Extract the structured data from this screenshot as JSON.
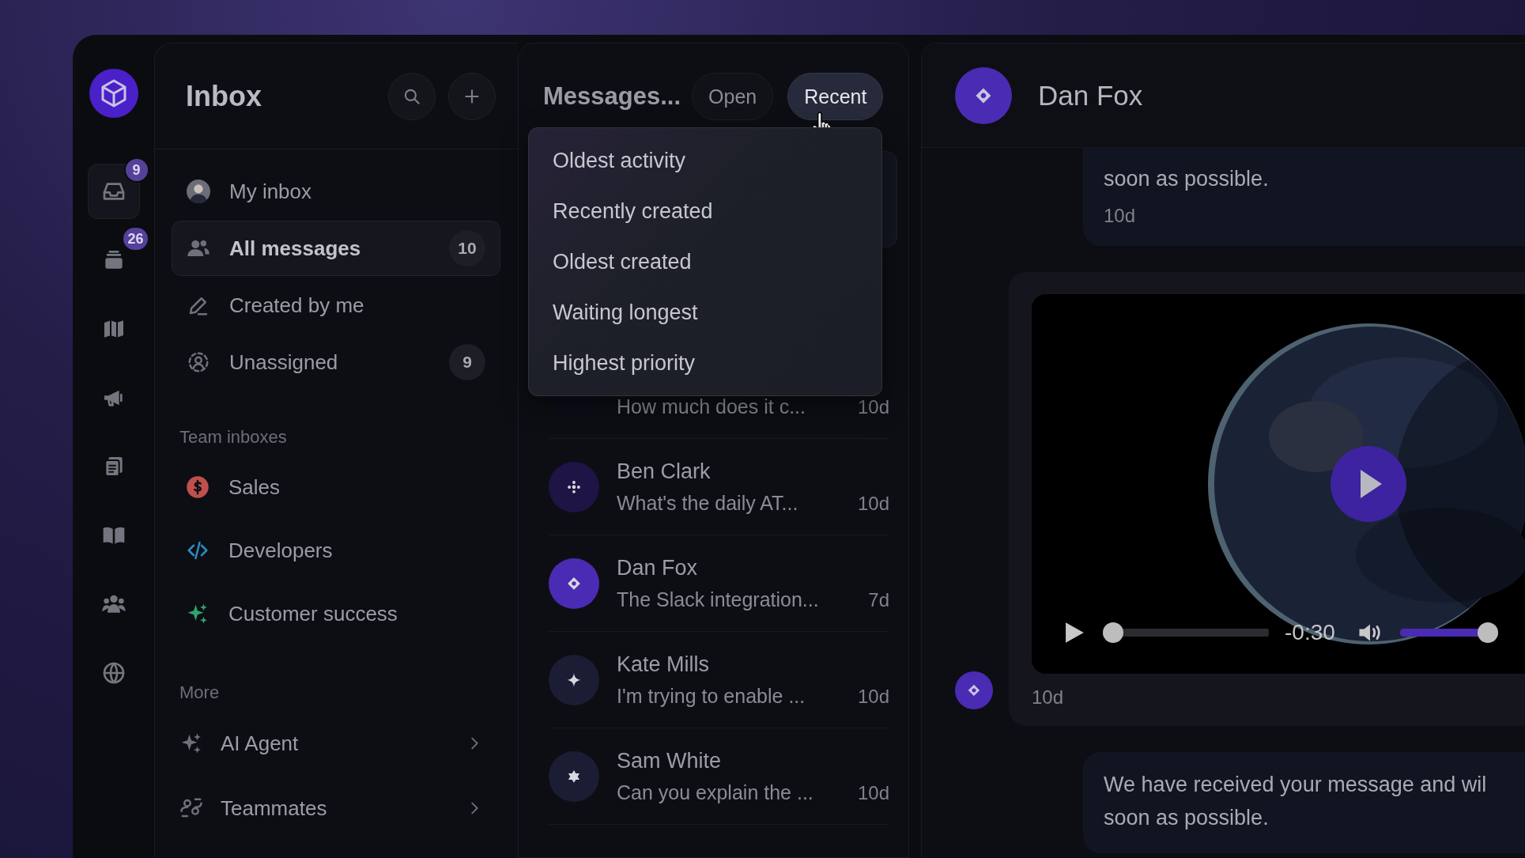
{
  "rail": {
    "items": [
      {
        "badge": "9",
        "selected": true
      },
      {
        "badge": "26",
        "selected": false
      },
      {
        "selected": false
      },
      {
        "selected": false
      },
      {
        "selected": false
      },
      {
        "selected": false
      },
      {
        "selected": false
      },
      {
        "selected": false
      }
    ]
  },
  "sidebar": {
    "title": "Inbox",
    "items": [
      {
        "label": "My inbox",
        "selected": false
      },
      {
        "label": "All messages",
        "count": "10",
        "selected": true
      },
      {
        "label": "Created by me",
        "selected": false
      },
      {
        "label": "Unassigned",
        "count": "9",
        "selected": false
      }
    ],
    "sections": [
      {
        "title": "Team inboxes",
        "items": [
          {
            "label": "Sales",
            "color": "#c0504d",
            "submenu": false
          },
          {
            "label": "Developers",
            "color": "#2e8bc0",
            "submenu": false
          },
          {
            "label": "Customer success",
            "color": "#2fa36b",
            "submenu": false
          }
        ]
      },
      {
        "title": "More",
        "items": [
          {
            "label": "AI Agent",
            "submenu": true
          },
          {
            "label": "Teammates",
            "submenu": true
          }
        ]
      }
    ]
  },
  "messages": {
    "title": "Messages...",
    "filters": [
      {
        "label": "Open",
        "selected": false
      },
      {
        "label": "Recent",
        "selected": true
      }
    ],
    "sort_menu": [
      "Oldest activity",
      "Recently created",
      "Oldest created",
      "Waiting longest",
      "Highest priority"
    ],
    "conversations": [
      {
        "preview": "How much does it c...",
        "time": "10d",
        "color": "#0b0d1a"
      },
      {
        "name": "Ben Clark",
        "preview": "What's the daily AT...",
        "time": "10d",
        "color": "#1e1445"
      },
      {
        "name": "Dan Fox",
        "preview": "The Slack integration...",
        "time": "7d",
        "color": "#4a2bb3"
      },
      {
        "name": "Kate Mills",
        "preview": "I'm trying to enable ...",
        "time": "10d",
        "color": "#1a1d33"
      },
      {
        "name": "Sam White",
        "preview": "Can you explain the ...",
        "time": "10d",
        "color": "#1a1d33"
      }
    ]
  },
  "chat": {
    "contact": {
      "name": "Dan Fox"
    },
    "messages": [
      {
        "kind": "text",
        "lines": [
          "soon as possible."
        ],
        "time": "10d"
      },
      {
        "kind": "video",
        "remaining": "-0:30",
        "progress": {
          "level": 0
        },
        "volume": {
          "level": 1
        },
        "time": "10d"
      },
      {
        "kind": "text",
        "lines": [
          "We have received your message and wil",
          "soon as possible."
        ]
      }
    ]
  }
}
